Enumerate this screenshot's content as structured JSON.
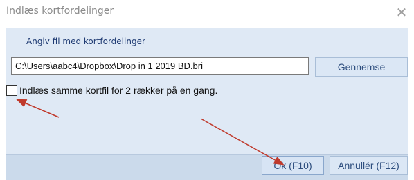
{
  "window": {
    "title": "Indlæs kortfordelinger",
    "close_glyph": "✕"
  },
  "file_group": {
    "label": "Angiv fil med kortfordelinger",
    "path_value": "C:\\Users\\aabc4\\Dropbox\\Drop in 1  2019 BD.bri",
    "browse_label": "Gennemse"
  },
  "option": {
    "checked": false,
    "label": "Indlæs samme kortfil for 2 rækker på en gang."
  },
  "buttons": {
    "ok_label": "Ok (F10)",
    "cancel_label": "Annullér (F12)"
  },
  "colors": {
    "panel": "#dfe9f5",
    "footer": "#cbdaeb",
    "annotation_arrow": "#c0392b"
  },
  "icons": {
    "close": "close-icon"
  }
}
